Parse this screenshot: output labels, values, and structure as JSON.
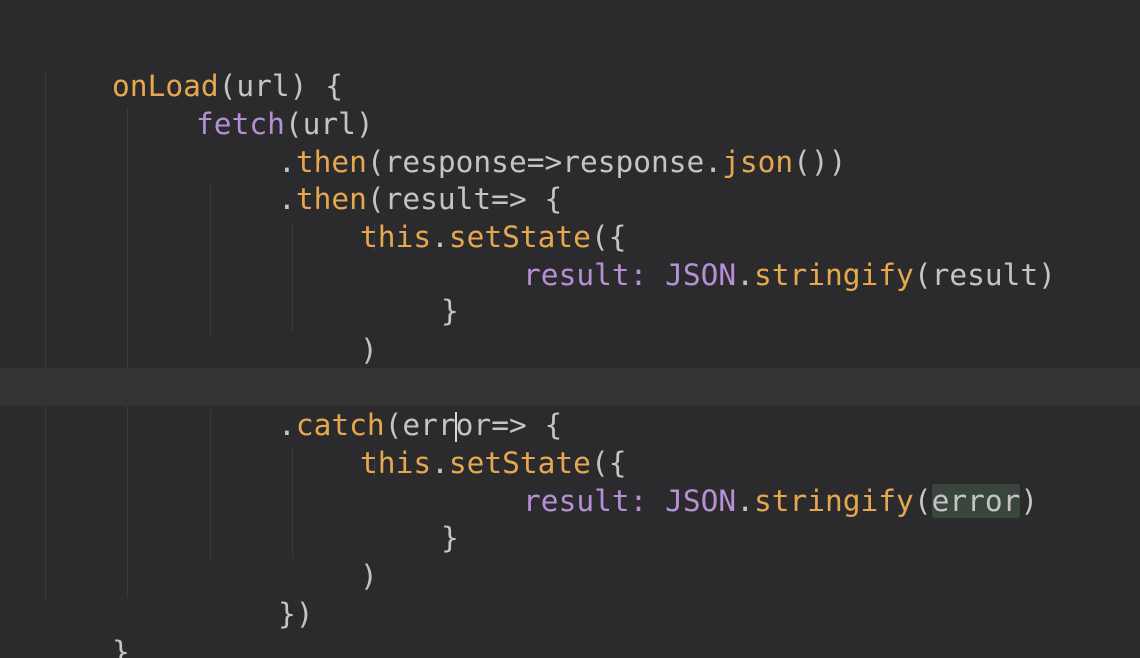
{
  "code": {
    "l1": {
      "fn_name": "onLoad",
      "args": "(url) {"
    },
    "l2": {
      "call": "fetch",
      "args": "(url)"
    },
    "l3": {
      "dot": ".",
      "method": "then",
      "open": "(response=>response.",
      "inner": "json",
      "close": "())"
    },
    "l4": {
      "dot": ".",
      "method": "then",
      "rest": "(result=> {"
    },
    "l5": {
      "this": "this",
      "dot": ".",
      "method": "setState",
      "rest": "({"
    },
    "l6": {
      "prop": "result:",
      "obj": "JSON",
      "dot": ".",
      "method": "stringify",
      "rest": "(result)"
    },
    "l7": {
      "text": "}"
    },
    "l8": {
      "text": ")"
    },
    "l9": {
      "text": "})"
    },
    "l10": {
      "dot": ".",
      "method": "catch",
      "open": "(err",
      "after_cursor": "or=> {"
    },
    "l11": {
      "this": "this",
      "dot": ".",
      "method": "setState",
      "rest": "({"
    },
    "l12": {
      "prop": "result:",
      "obj": "JSON",
      "dot": ".",
      "method": "stringify",
      "open": "(",
      "arg": "error",
      "close": ")"
    },
    "l13": {
      "text": "}"
    },
    "l14": {
      "text": ")"
    },
    "l15": {
      "text": "})"
    },
    "l16": {
      "text": "}"
    }
  },
  "colors": {
    "background": "#2b2b2d",
    "default_text": "#c4c4c7",
    "function_orange": "#e5a84f",
    "keyword_purple": "#b78fd4"
  }
}
